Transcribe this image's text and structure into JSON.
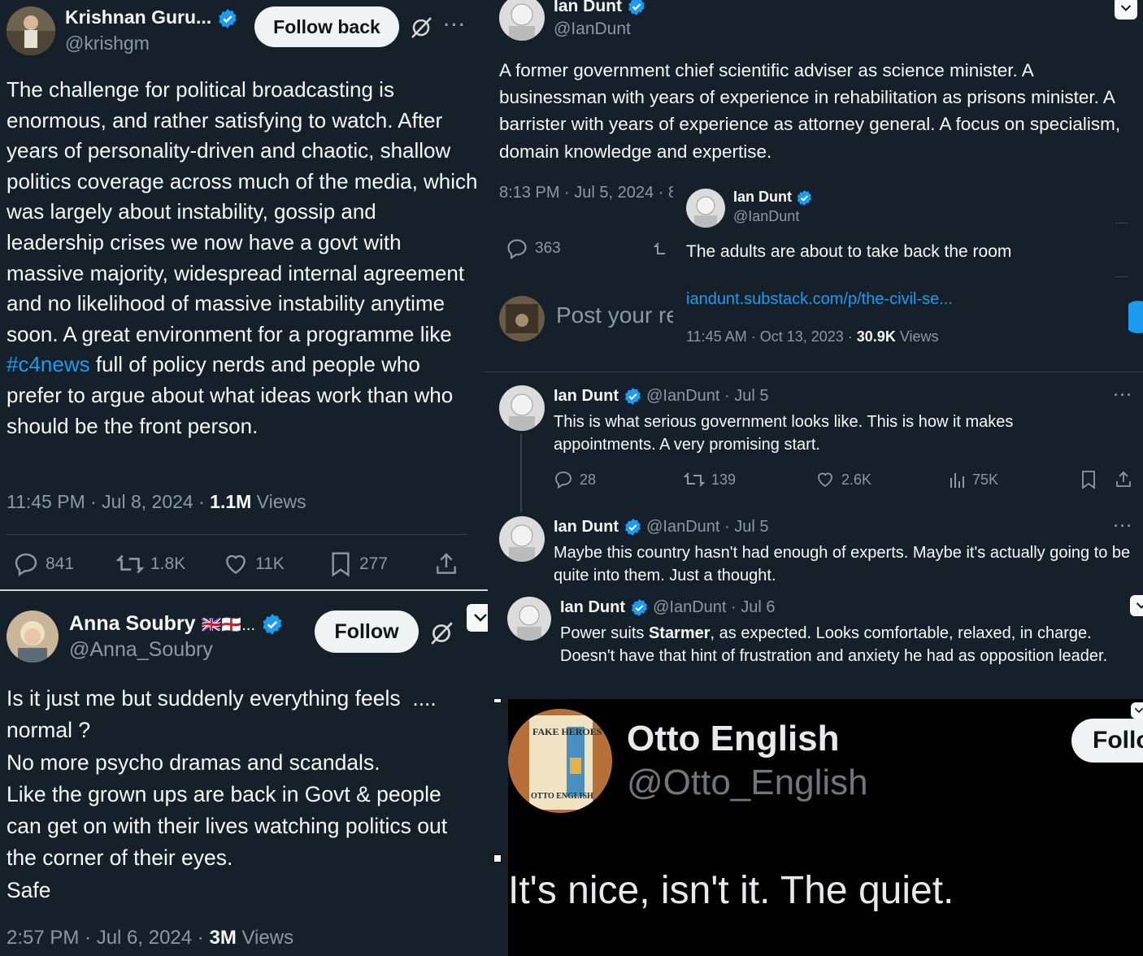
{
  "tweet1": {
    "name": "Krishnan Guru...",
    "handle": "@krishgm",
    "follow_label": "Follow back",
    "text_a": "The challenge for political broadcasting is enormous, and rather satisfying to watch. After years of personality-driven and chaotic, shallow politics coverage across much of the media, which was largely about instability, gossip and leadership crises we now have a govt with massive majority, widespread internal agreement and no likelihood of massive instability anytime soon. A great environment for a programme like ",
    "hashtag": "#c4news",
    "text_b": " full of policy nerds and people who prefer to argue about what ideas work than who should be the front person.",
    "time": "11:45 PM · Jul 8, 2024 · ",
    "views_count": "1.1M",
    "views_label": " Views",
    "replies": "841",
    "retweets": "1.8K",
    "likes": "11K",
    "bookmarks": "277"
  },
  "tweet2": {
    "name": "Anna Soubry",
    "flags": "🇬🇧🏴󠁧󠁢󠁥󠁮󠁧󠁿...",
    "handle": "@Anna_Soubry",
    "follow_label": "Follow",
    "lines": [
      "Is it just me but suddenly everything feels  ....",
      "normal ?",
      "No more psycho dramas and scandals.",
      "Like the grown ups are back in Govt & people",
      "can get on with their lives watching politics out",
      "the corner of their eyes.",
      "Safe"
    ],
    "time": "2:57 PM · Jul 6, 2024 · ",
    "views_count": "3M",
    "views_label": " Views"
  },
  "tweet3": {
    "name": "Ian Dunt",
    "handle": "@IanDunt",
    "text": "A former government chief scientific adviser as science minister. A businessman with years of experience in rehabilitation as prisons minister. A barrister with years of experience as attorney general. A focus on specialism, domain knowledge and expertise.",
    "time": "8:13 PM · Jul 5, 2024 · 8",
    "replies": "363",
    "reply_placeholder": "Post your re",
    "quote": {
      "name": "Ian Dunt",
      "handle": "@IanDunt",
      "text": "The adults are about to take back the room",
      "link": "iandunt.substack.com/p/the-civil-se...",
      "time": "11:45 AM · Oct 13, 2023 · ",
      "views_count": "30.9K",
      "views_label": " Views"
    }
  },
  "thread": [
    {
      "name": "Ian Dunt",
      "handle": "@IanDunt · Jul 5",
      "text": "This is what serious government looks like. This is how it makes appointments. A very promising start.",
      "replies": "28",
      "retweets": "139",
      "likes": "2.6K",
      "views": "75K"
    },
    {
      "name": "Ian Dunt",
      "handle": "@IanDunt · Jul 5",
      "text": "Maybe this country hasn't had enough of experts. Maybe it's actually going to be quite into them. Just a thought."
    },
    {
      "name": "Ian Dunt",
      "handle": "@IanDunt · Jul 6",
      "text_a": "Power suits ",
      "text_bold": "Starmer",
      "text_b": ", as expected. Looks comfortable, relaxed, in charge. Doesn't have that hint of frustration and anxiety he had as opposition leader."
    }
  ],
  "tweet5": {
    "name": "Otto English",
    "handle": "@Otto_English",
    "follow_label": "Follo",
    "text": "It's nice, isn't it. The quiet.",
    "book_top": "FAKE HEROES",
    "book_bottom": "OTTO ENGLISH"
  },
  "colors": {
    "background": "#15202b",
    "black_panel": "#000000",
    "link": "#1d9bf0",
    "muted": "#8b98a5",
    "verified": "#1d9bf0"
  }
}
